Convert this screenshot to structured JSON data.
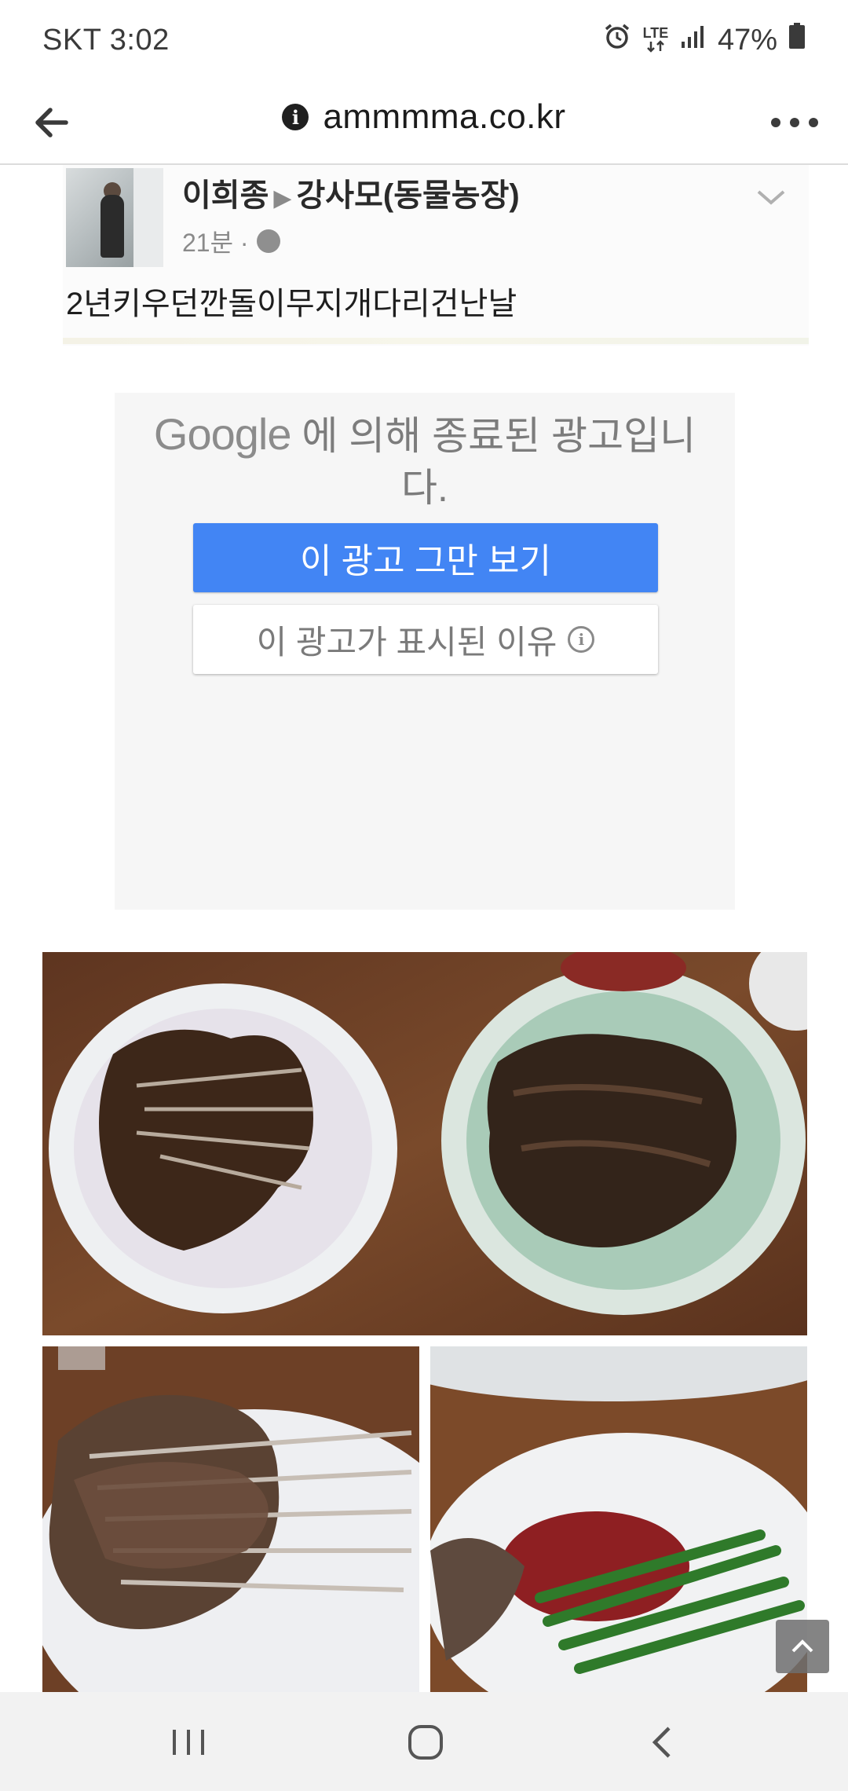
{
  "status_bar": {
    "carrier_time": "SKT 3:02",
    "network": "LTE",
    "battery": "47%",
    "icons": [
      "alarm-icon",
      "lte-icon",
      "signal-icon",
      "battery-icon"
    ]
  },
  "browser": {
    "url": "ammmma.co.kr",
    "icons": [
      "back-arrow-icon",
      "info-icon",
      "more-icon"
    ]
  },
  "post": {
    "author": "이희종",
    "group": "강사모(동물농장)",
    "time": "21분 ·",
    "text": "2년키우던깐돌이무지개다리건난날"
  },
  "ad": {
    "google_logo": "Google",
    "closed_message": "에 의해 종료된 광고입니다.",
    "stop_button": "이 광고 그만 보기",
    "why_button": "이 광고가 표시된 이유",
    "colors": {
      "stop_button_bg": "#4285f4",
      "box_bg": "#f6f6f6"
    }
  },
  "photos": {
    "count": 3
  },
  "nav_bar": {
    "icons": [
      "recent-apps-icon",
      "home-icon",
      "back-icon"
    ]
  }
}
